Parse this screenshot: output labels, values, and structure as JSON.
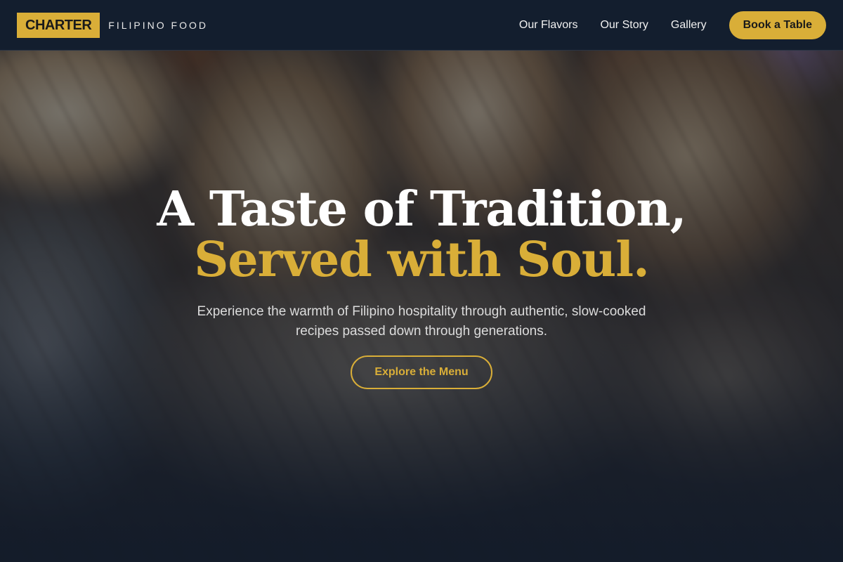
{
  "brand": {
    "logo_text": "CHARTER",
    "tagline": "FILIPINO FOOD"
  },
  "nav": {
    "links": [
      {
        "label": "Our Flavors"
      },
      {
        "label": "Our Story"
      },
      {
        "label": "Gallery"
      }
    ],
    "cta_label": "Book a Table"
  },
  "hero": {
    "headline_line1": "A Taste of Tradition,",
    "headline_line2": "Served with Soul.",
    "subtext": "Experience the warmth of Filipino hospitality through authentic, slow-cooked recipes passed down through generations.",
    "cta_label": "Explore the Menu",
    "background_image": "grilled-food-photo"
  },
  "colors": {
    "accent": "#d9ae38",
    "nav_background": "#131e2e",
    "overlay": "#101a2a"
  }
}
